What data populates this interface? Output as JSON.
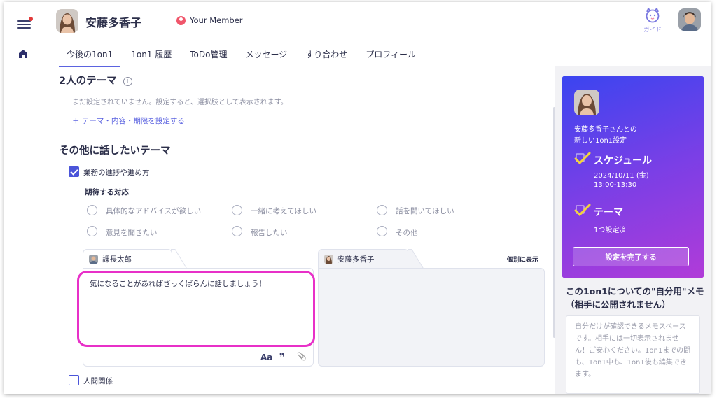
{
  "header": {
    "user_name": "安藤多香子",
    "member_label": "Your Member",
    "guide_label": "ガイド"
  },
  "tabs": [
    {
      "label": "今後の1on1",
      "active": true
    },
    {
      "label": "1on1 履歴"
    },
    {
      "label": "ToDo管理"
    },
    {
      "label": "メッセージ"
    },
    {
      "label": "すり合わせ"
    },
    {
      "label": "プロフィール"
    }
  ],
  "themes_section": {
    "title": "2人のテーマ",
    "empty_text": "まだ設定されていません。設定すると、選択肢として表示されます。",
    "add_link": "＋ テーマ・内容・期限を設定する"
  },
  "other_section": {
    "title": "その他に話したいテーマ",
    "item1": {
      "label": "業務の進捗や進め方",
      "checked": true
    },
    "expected_title": "期待する対応",
    "options": [
      "具体的なアドバイスが欲しい",
      "一緒に考えてほしい",
      "話を聞いてほしい",
      "意見を聞きたい",
      "報告したい",
      "その他"
    ],
    "memo_left": {
      "author": "課長太郎",
      "text": "気になることがあればざっくばらんに話しましょう！",
      "tools": {
        "font": "Aa",
        "quote": "❞",
        "attach": "📎"
      }
    },
    "memo_right": {
      "author": "安藤多香子",
      "separate_label": "個別に表示"
    },
    "item2": {
      "label": "人間関係",
      "checked": false
    }
  },
  "card": {
    "line1": "安藤多香子さんとの",
    "line2": "新しい1on1設定",
    "schedule_title": "スケジュール",
    "schedule_date": "2024/10/11 (金)",
    "schedule_time": "13:00-13:30",
    "theme_title": "テーマ",
    "theme_sub": "1つ設定済",
    "button": "設定を完了する"
  },
  "self_memo": {
    "title_line1": "この1on1についての\"自分用\"メモ",
    "title_line2": "（相手に公開されません）",
    "placeholder": "自分だけが確認できるメモスペースです。相手には一切表示されません！ご安心ください。1on1までの間も、1on1中も、1on1後も編集できます。"
  },
  "colors": {
    "accent": "#5b63e0",
    "highlight": "#e830c8",
    "card_gradient_start": "#3a45f0",
    "card_gradient_end": "#b13bd8",
    "check_yellow": "#f5d43a"
  }
}
